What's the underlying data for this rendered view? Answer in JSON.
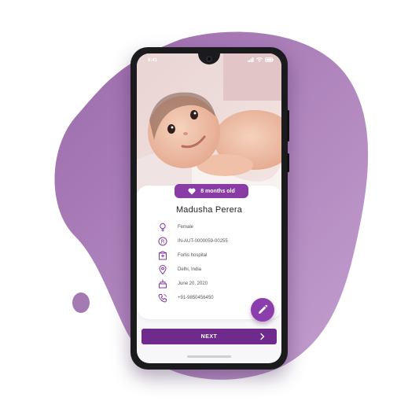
{
  "statusbar": {
    "time": "9:41"
  },
  "profile": {
    "age_badge": "8 months old",
    "name": "Madusha Perera",
    "details": [
      {
        "icon": "gender-icon",
        "text": "Female"
      },
      {
        "icon": "registered-icon",
        "text": "IN-AUT-0000059-00255"
      },
      {
        "icon": "hospital-icon",
        "text": "Fortis hospital"
      },
      {
        "icon": "location-pin-icon",
        "text": "Delhi, India"
      },
      {
        "icon": "birthday-cake-icon",
        "text": "June 20, 2020"
      },
      {
        "icon": "phone-icon",
        "text": "+91-9850456450"
      }
    ]
  },
  "actions": {
    "next_label": "NEXT",
    "edit_icon": "pencil-icon"
  },
  "colors": {
    "accent": "#8a3ca6",
    "next_button": "#6e2a8d",
    "blob": "#a070b0",
    "icon": "#7d3aa0"
  }
}
